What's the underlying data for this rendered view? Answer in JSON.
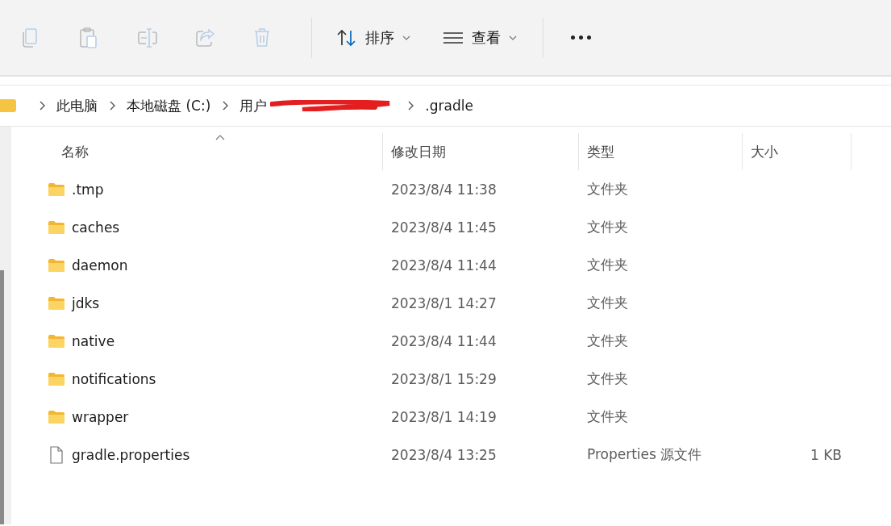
{
  "toolbar": {
    "actions": [
      {
        "kind": "copy",
        "disabled": true
      },
      {
        "kind": "paste",
        "disabled": true
      },
      {
        "kind": "rename",
        "disabled": true
      },
      {
        "kind": "share",
        "disabled": true
      },
      {
        "kind": "delete",
        "disabled": true
      }
    ],
    "menus": [
      {
        "kind": "sort",
        "label": "排序"
      },
      {
        "kind": "view",
        "label": "查看"
      }
    ]
  },
  "breadcrumb": {
    "segments": [
      {
        "label": "此电脑"
      },
      {
        "label": "本地磁盘 (C:)"
      },
      {
        "label": "用户",
        "redacted_after": true
      },
      {
        "label": ".gradle"
      }
    ]
  },
  "table": {
    "columns": [
      {
        "label": "名称",
        "sorted": true
      },
      {
        "label": "修改日期",
        "sorted": false
      },
      {
        "label": "类型",
        "sorted": false
      },
      {
        "label": "大小",
        "sorted": false
      }
    ],
    "rows": [
      {
        "kind": "folder",
        "name": ".tmp",
        "date": "2023/8/4 11:38",
        "type": "文件夹"
      },
      {
        "kind": "folder",
        "name": "caches",
        "date": "2023/8/4 11:45",
        "type": "文件夹"
      },
      {
        "kind": "folder",
        "name": "daemon",
        "date": "2023/8/4 11:44",
        "type": "文件夹"
      },
      {
        "kind": "folder",
        "name": "jdks",
        "date": "2023/8/1 14:27",
        "type": "文件夹"
      },
      {
        "kind": "folder",
        "name": "native",
        "date": "2023/8/4 11:44",
        "type": "文件夹"
      },
      {
        "kind": "folder",
        "name": "notifications",
        "date": "2023/8/1 15:29",
        "type": "文件夹"
      },
      {
        "kind": "folder",
        "name": "wrapper",
        "date": "2023/8/1 14:19",
        "type": "文件夹"
      },
      {
        "kind": "file",
        "name": "gradle.properties",
        "date": "2023/8/4 13:25",
        "type": "Properties 源文件",
        "size": "1 KB"
      }
    ]
  }
}
